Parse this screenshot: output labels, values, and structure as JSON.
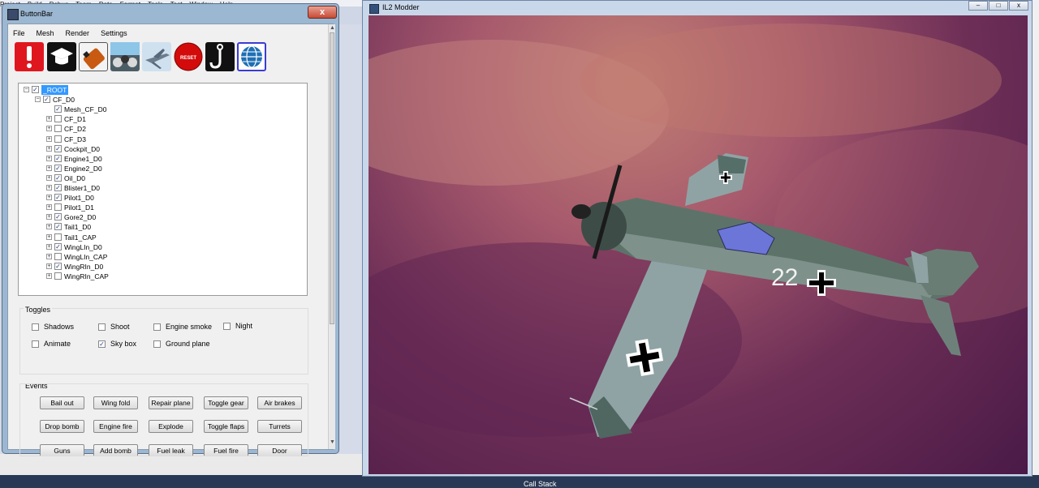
{
  "ide": {
    "menu": [
      "Project",
      "Build",
      "Debug",
      "Team",
      "Data",
      "Format",
      "Tools",
      "Test",
      "Window",
      "Help"
    ],
    "bottom_panel_label": "Call Stack"
  },
  "buttonbar": {
    "title": "ButtonBar",
    "close_label": "x",
    "menu": [
      "File",
      "Mesh",
      "Render",
      "Settings"
    ],
    "tools": [
      {
        "name": "alert-icon",
        "color": "#e0161f"
      },
      {
        "name": "graduation-cap-icon",
        "color": "#111111"
      },
      {
        "name": "fuel-tank-icon",
        "color": "#c85a12"
      },
      {
        "name": "cockpit-icon",
        "color": "#3b4a52"
      },
      {
        "name": "aircraft-icon",
        "color": "#8aa0b6"
      },
      {
        "name": "reset-icon",
        "color": "#d40b0b",
        "label": "RESET"
      },
      {
        "name": "hook-icon",
        "color": "#111111"
      },
      {
        "name": "globe-icon",
        "color": "#1f6fb5"
      }
    ],
    "tree": [
      {
        "label": "_ROOT",
        "checked": true,
        "level": 0,
        "expander": "-",
        "selected": true
      },
      {
        "label": "CF_D0",
        "checked": true,
        "level": 1,
        "expander": "-"
      },
      {
        "label": "Mesh_CF_D0",
        "checked": true,
        "level": 2,
        "expander": ""
      },
      {
        "label": "CF_D1",
        "checked": false,
        "level": 2,
        "expander": "+"
      },
      {
        "label": "CF_D2",
        "checked": false,
        "level": 2,
        "expander": "+"
      },
      {
        "label": "CF_D3",
        "checked": false,
        "level": 2,
        "expander": "+"
      },
      {
        "label": "Cockpit_D0",
        "checked": true,
        "level": 2,
        "expander": "+"
      },
      {
        "label": "Engine1_D0",
        "checked": true,
        "level": 2,
        "expander": "+"
      },
      {
        "label": "Engine2_D0",
        "checked": true,
        "level": 2,
        "expander": "+"
      },
      {
        "label": "Oil_D0",
        "checked": true,
        "level": 2,
        "expander": "+"
      },
      {
        "label": "Blister1_D0",
        "checked": true,
        "level": 2,
        "expander": "+"
      },
      {
        "label": "Pilot1_D0",
        "checked": true,
        "level": 2,
        "expander": "+"
      },
      {
        "label": "Pilot1_D1",
        "checked": false,
        "level": 2,
        "expander": "+"
      },
      {
        "label": "Gore2_D0",
        "checked": true,
        "level": 2,
        "expander": "+"
      },
      {
        "label": "Tail1_D0",
        "checked": true,
        "level": 2,
        "expander": "+"
      },
      {
        "label": "Tail1_CAP",
        "checked": false,
        "level": 2,
        "expander": "+"
      },
      {
        "label": "WingLIn_D0",
        "checked": true,
        "level": 2,
        "expander": "+"
      },
      {
        "label": "WingLIn_CAP",
        "checked": false,
        "level": 2,
        "expander": "+"
      },
      {
        "label": "WingRIn_D0",
        "checked": true,
        "level": 2,
        "expander": "+"
      },
      {
        "label": "WingRIn_CAP",
        "checked": false,
        "level": 2,
        "expander": "+"
      }
    ],
    "toggles_title": "Toggles",
    "toggles": [
      {
        "label": "Shadows",
        "checked": false
      },
      {
        "label": "Shoot",
        "checked": false
      },
      {
        "label": "Engine smoke",
        "checked": false
      },
      {
        "label": "Night",
        "checked": false
      },
      {
        "label": "Animate",
        "checked": false
      },
      {
        "label": "Sky box",
        "checked": true
      },
      {
        "label": "Ground plane",
        "checked": false
      }
    ],
    "events_title": "Events",
    "events": [
      "Bail out",
      "Wing fold",
      "Repair plane",
      "Toggle gear",
      "Air brakes",
      "Drop bomb",
      "Engine fire",
      "Explode",
      "Toggle flaps",
      "Turrets",
      "Guns",
      "Add bomb",
      "Fuel leak",
      "Fuel fire",
      "Door"
    ]
  },
  "il2": {
    "title": "IL2 Modder",
    "minimize": "–",
    "maximize": "□",
    "close": "x",
    "aircraft_number": "22",
    "sky_color": "#a5586c"
  }
}
